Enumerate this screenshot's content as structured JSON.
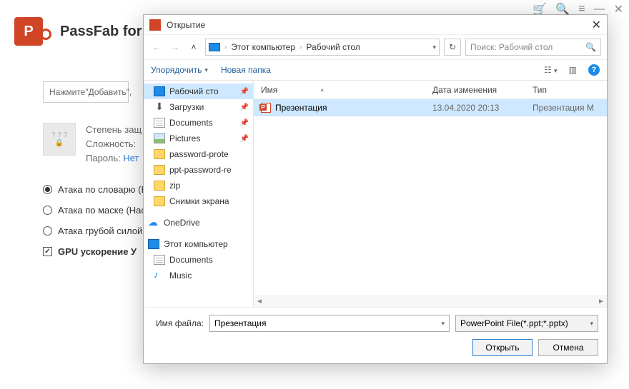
{
  "app": {
    "title": "PassFab for PPT",
    "add_placeholder": "Нажмите\"Добавить\",",
    "status_icon": "? ? ?",
    "status_lock": "🔒",
    "status": {
      "line1": "Степень защ",
      "line2": "Сложность:",
      "line3_label": "Пароль:",
      "line3_value": "Нет"
    },
    "attacks": {
      "dict": "Атака по словарю (В",
      "mask": "Атака по маске (Нас",
      "brute": "Атака грубой силой",
      "gpu": "GPU ускорение У"
    }
  },
  "dialog": {
    "title": "Открытие",
    "path": {
      "root": "Этот компьютер",
      "folder": "Рабочий стол"
    },
    "search_placeholder": "Поиск: Рабочий стол",
    "toolbar": {
      "organize": "Упорядочить",
      "newfolder": "Новая папка"
    },
    "columns": {
      "name": "Имя",
      "date": "Дата изменения",
      "type": "Тип"
    },
    "sidebar": {
      "desktop": "Рабочий сто",
      "downloads": "Загрузки",
      "documents": "Documents",
      "pictures": "Pictures",
      "f1": "password-prote",
      "f2": "ppt-password-re",
      "f3": "zip",
      "f4": "Снимки экрана",
      "onedrive": "OneDrive",
      "thispc": "Этот компьютер",
      "docs2": "Documents",
      "music": "Music"
    },
    "file": {
      "name": "Презентация",
      "date": "13.04.2020 20:13",
      "type": "Презентация M"
    },
    "filename_label": "Имя файла:",
    "filename_value": "Презентация",
    "filter": "PowerPoint File(*.ppt;*.pptx)",
    "open": "Открыть",
    "cancel": "Отмена"
  }
}
